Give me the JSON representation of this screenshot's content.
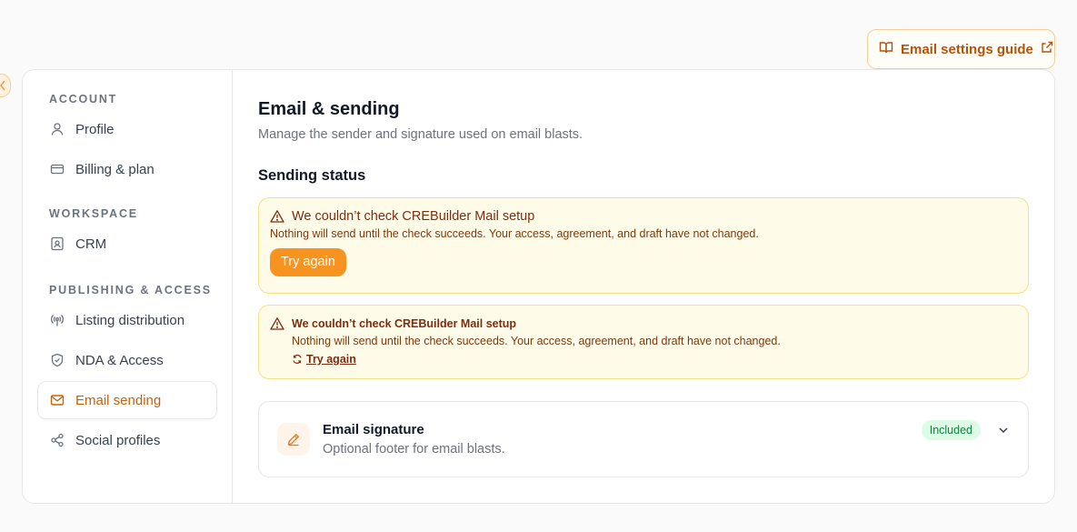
{
  "header": {
    "guide_label": "Email settings guide",
    "guide_icon": "book-open-icon",
    "external_icon": "external-link-icon"
  },
  "sidebar": {
    "sections": [
      {
        "label": "ACCOUNT",
        "items": [
          {
            "label": "Profile",
            "icon": "user-icon"
          },
          {
            "label": "Billing & plan",
            "icon": "credit-card-icon"
          }
        ]
      },
      {
        "label": "WORKSPACE",
        "items": [
          {
            "label": "CRM",
            "icon": "contact-icon"
          }
        ]
      },
      {
        "label": "PUBLISHING & ACCESS",
        "items": [
          {
            "label": "Listing distribution",
            "icon": "broadcast-icon"
          },
          {
            "label": "NDA & Access",
            "icon": "shield-icon"
          },
          {
            "label": "Email sending",
            "icon": "mail-icon",
            "active": true
          },
          {
            "label": "Social profiles",
            "icon": "share-icon"
          }
        ]
      }
    ]
  },
  "main": {
    "title": "Email & sending",
    "subtitle": "Manage the sender and signature used on email blasts.",
    "section_title": "Sending status",
    "alert_primary": {
      "title": "We couldn’t check CREBuilder Mail setup",
      "body": "Nothing will send until the check succeeds. Your access, agreement, and draft have not changed.",
      "action": "Try again"
    },
    "alert_compact": {
      "title": "We couldn’t check CREBuilder Mail setup",
      "body": "Nothing will send until the check succeeds. Your access, agreement, and draft have not changed.",
      "action": "Try again"
    },
    "signature": {
      "title": "Email signature",
      "subtitle": "Optional footer for email blasts.",
      "badge": "Included"
    }
  },
  "colors": {
    "accent": "#f7931e",
    "accent_text": "#c2620c",
    "warning_bg": "#fefbe8",
    "success_bg": "#dcfce7"
  }
}
